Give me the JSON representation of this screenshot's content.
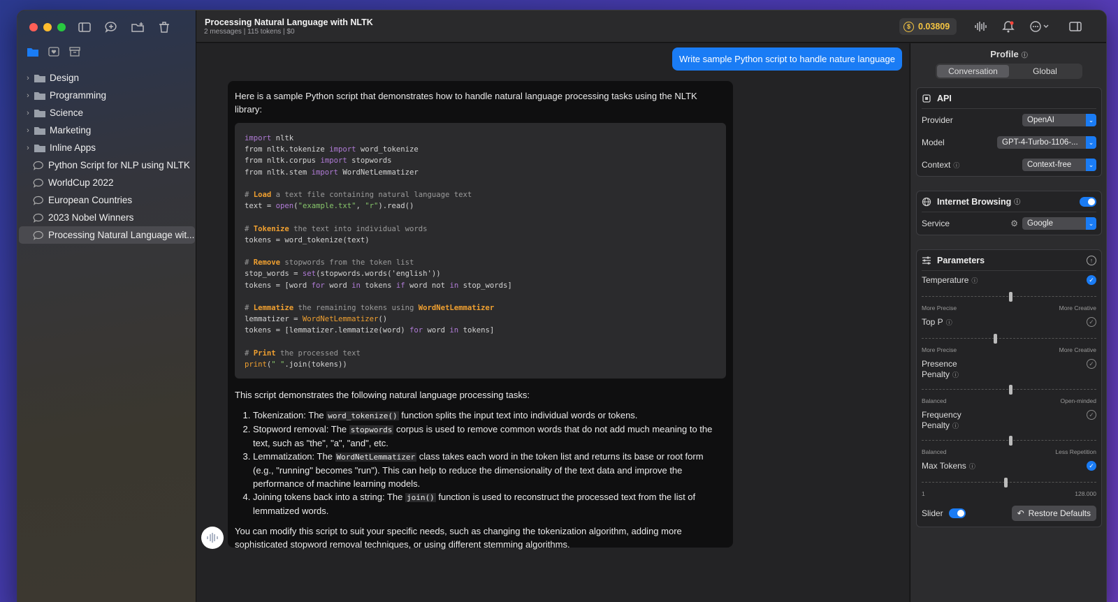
{
  "sidebar": {
    "tree": [
      {
        "label": "Design",
        "type": "folder"
      },
      {
        "label": "Programming",
        "type": "folder"
      },
      {
        "label": "Science",
        "type": "folder"
      },
      {
        "label": "Marketing",
        "type": "folder"
      },
      {
        "label": "Inline Apps",
        "type": "folder"
      },
      {
        "label": "Python Script for NLP using NLTK",
        "type": "chat"
      },
      {
        "label": "WorldCup 2022",
        "type": "chat"
      },
      {
        "label": "European Countries",
        "type": "chat"
      },
      {
        "label": "2023 Nobel Winners",
        "type": "chat"
      },
      {
        "label": "Processing Natural Language wit...",
        "type": "chat",
        "selected": true
      }
    ]
  },
  "header": {
    "title": "Processing Natural Language with NLTK",
    "meta": "2 messages  |  115 tokens  |  $0",
    "cost": "0.03809"
  },
  "chat": {
    "user_message": "Write sample Python script to handle nature language",
    "intro": "Here is a sample Python script that demonstrates how to handle natural language processing tasks using the NLTK library:",
    "summary": "This script demonstrates the following natural language processing tasks:",
    "list": [
      {
        "pre": "Tokenization: The ",
        "code": "word_tokenize()",
        "post": " function splits the input text into individual words or tokens."
      },
      {
        "pre": "Stopword removal: The ",
        "code": "stopwords",
        "post": " corpus is used to remove common words that do not add much meaning to the text, such as \"the\", \"a\", \"and\", etc."
      },
      {
        "pre": "Lemmatization: The ",
        "code": "WordNetLemmatizer",
        "post": " class takes each word in the token list and returns its base or root form (e.g., \"running\" becomes \"run\"). This can help to reduce the dimensionality of the text data and improve the performance of machine learning models."
      },
      {
        "pre": "Joining tokens back into a string: The ",
        "code": "join()",
        "post": " function is used to reconstruct the processed text from the list of lemmatized words."
      }
    ],
    "outro": "You can modify this script to suit your specific needs, such as changing the tokenization algorithm, adding more sophisticated stopword removal techniques, or using different stemming algorithms."
  },
  "panel": {
    "title": "Profile",
    "tabs": [
      "Conversation",
      "Global"
    ],
    "api": {
      "title": "API",
      "provider_label": "Provider",
      "provider": "OpenAI",
      "model_label": "Model",
      "model": "GPT-4-Turbo-1106-...",
      "context_label": "Context",
      "context": "Context-free"
    },
    "browsing": {
      "title": "Internet Browsing",
      "service_label": "Service",
      "service": "Google"
    },
    "parameters": {
      "title": "Parameters",
      "items": [
        {
          "label": "Temperature",
          "left": "More Precise",
          "right": "More Creative",
          "checked": true,
          "level": 0.5
        },
        {
          "label": "Top P",
          "left": "More Precise",
          "right": "More Creative",
          "checked": false,
          "level": 0.41
        },
        {
          "label": "Presence Penalty",
          "left": "Balanced",
          "right": "Open-minded",
          "checked": false,
          "level": 0.5
        },
        {
          "label": "Frequency Penalty",
          "left": "Balanced",
          "right": "Less Repetition",
          "checked": false,
          "level": 0.5
        },
        {
          "label": "Max Tokens",
          "left": "1",
          "right": "128.000",
          "checked": true,
          "level": 0.47
        }
      ],
      "slider_label": "Slider",
      "restore_label": "Restore Defaults"
    }
  }
}
